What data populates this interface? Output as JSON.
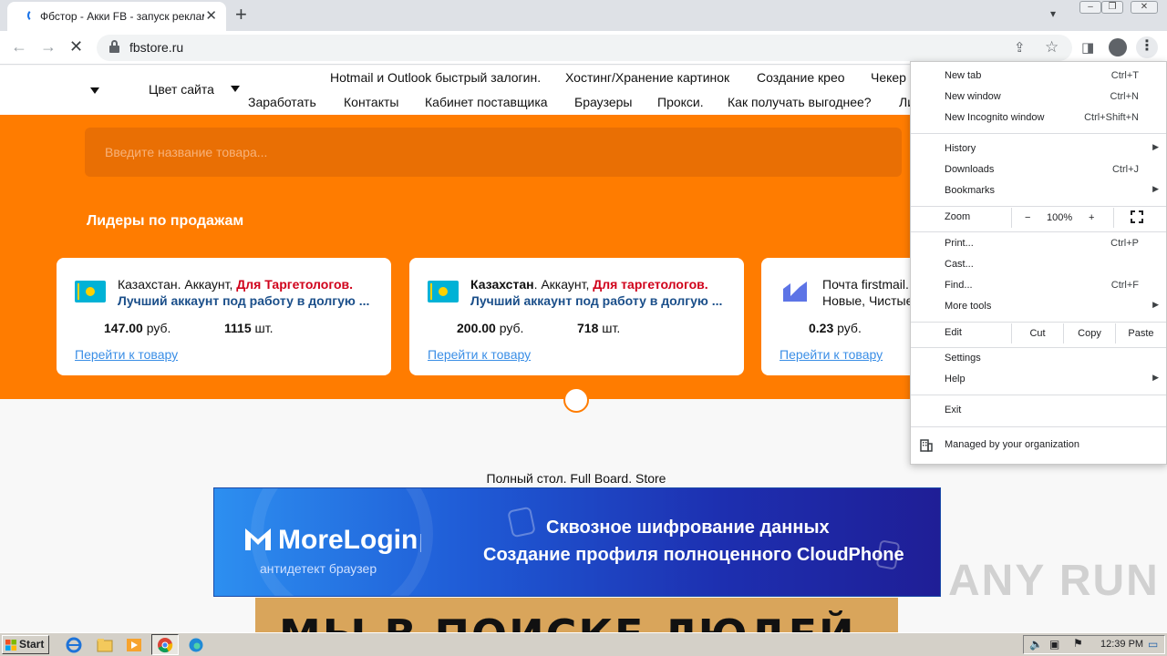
{
  "browser": {
    "tab_title": "Фбстор - Акки FB - запуск реклам",
    "tab_close": "✕",
    "new_tab": "+",
    "url": "fbstore.ru",
    "colors": {
      "accent": "#1a73e8",
      "tab_strip": "#dee1e6"
    }
  },
  "site": {
    "header": {
      "site_color_label": "Цвет сайта",
      "nav_row1": [
        "Hotmail и Outlook быстрый залогин.",
        "Хостинг/Хранение картинок",
        "Создание крео",
        "Чекер"
      ],
      "nav_row2": [
        "Заработать",
        "Контакты",
        "Кабинет поставщика",
        "Браузеры",
        "Прокси.",
        "Как получать выгоднее?",
        "Ли"
      ]
    },
    "search": {
      "placeholder": "Введите название товара..."
    },
    "leaders": {
      "title": "Лидеры по продажам",
      "cards": [
        {
          "title_plain": "Казахстан. Аккаунт, ",
          "title_red": "Для Таргетологов.",
          "subtitle": "Лучший аккаунт под работу в долгую ...",
          "price": "147.00",
          "currency": " руб.",
          "qty": "1115",
          "qty_unit": " шт.",
          "link": "Перейти к товару",
          "icon": "kazakhstan-flag-icon"
        },
        {
          "title_bold": "Казахстан",
          "title_plain": ". Аккаунт, ",
          "title_red": "Для таргетологов.",
          "subtitle": "Лучший аккаунт под работу в долгую ...",
          "price": "200.00",
          "currency": " руб.",
          "qty": "718",
          "qty_unit": " шт.",
          "link": "Перейти к товару",
          "icon": "kazakhstan-flag-icon"
        },
        {
          "title_plain": "Почта firstmail.",
          "subtitle": "Новые, Чистые",
          "price": "0.23",
          "currency": " руб.",
          "link": "Перейти к товару",
          "icon": "firstmail-logo-icon"
        }
      ]
    },
    "board_caption": "Полный стол. Full Board. Store",
    "banner": {
      "brand": "MoreLogin",
      "sub": "антидетект браузер",
      "line1": "Сквозное шифрование данных",
      "line2": "Создание профиля полноценного CloudPhone"
    },
    "poster_text": "МЫ В ПОИСКЕ ЛЮДЕЙ",
    "watermark": "ANY RUN",
    "colors": {
      "orange": "#ff7c00",
      "search_bg": "#e96f04",
      "red": "#d0021b",
      "link": "#3a8ee6",
      "subtitle": "#1b4f8a"
    }
  },
  "menu": {
    "new_tab": {
      "label": "New tab",
      "shortcut": "Ctrl+T"
    },
    "new_window": {
      "label": "New window",
      "shortcut": "Ctrl+N"
    },
    "incognito": {
      "label": "New Incognito window",
      "shortcut": "Ctrl+Shift+N"
    },
    "history": {
      "label": "History"
    },
    "downloads": {
      "label": "Downloads",
      "shortcut": "Ctrl+J"
    },
    "bookmarks": {
      "label": "Bookmarks"
    },
    "zoom": {
      "label": "Zoom",
      "minus": "−",
      "value": "100%",
      "plus": "+"
    },
    "print": {
      "label": "Print...",
      "shortcut": "Ctrl+P"
    },
    "cast": {
      "label": "Cast..."
    },
    "find": {
      "label": "Find...",
      "shortcut": "Ctrl+F"
    },
    "more_tools": {
      "label": "More tools"
    },
    "edit": {
      "label": "Edit",
      "cut": "Cut",
      "copy": "Copy",
      "paste": "Paste"
    },
    "settings": {
      "label": "Settings"
    },
    "help": {
      "label": "Help"
    },
    "exit": {
      "label": "Exit"
    },
    "managed": {
      "label": "Managed by your organization"
    }
  },
  "taskbar": {
    "start": "Start",
    "clock": "12:39 PM"
  }
}
